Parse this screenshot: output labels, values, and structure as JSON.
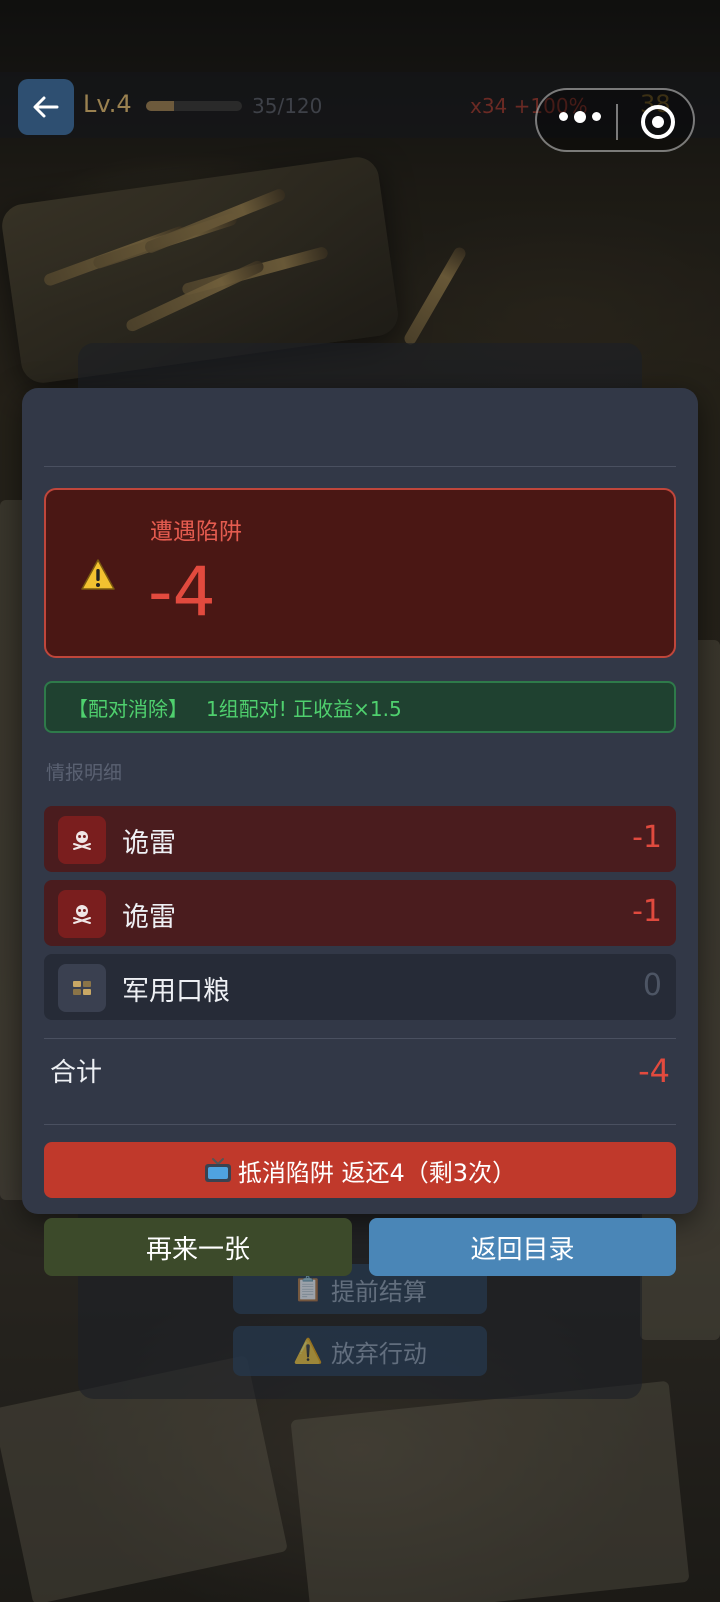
{
  "header": {
    "level": "Lv.4",
    "xp_text": "35/120",
    "xp_fraction": 0.29,
    "multiplier": "x34 +100%",
    "coins": "38"
  },
  "background_menu": {
    "settle_label": "提前结算",
    "abandon_label": "放弃行动"
  },
  "result": {
    "trap_title": "遭遇陷阱",
    "trap_value": "-4",
    "combo_tag": "【配对消除】",
    "combo_text": "1组配对! 正收益×1.5",
    "details_label": "情报明细",
    "items": [
      {
        "name": "诡雷",
        "value": "-1",
        "icon": "skull-icon",
        "type": "bad"
      },
      {
        "name": "诡雷",
        "value": "-1",
        "icon": "skull-icon",
        "type": "bad"
      },
      {
        "name": "军用口粮",
        "value": "0",
        "icon": "ration-icon",
        "type": "neutral"
      }
    ],
    "total_label": "合计",
    "total_value": "-4"
  },
  "actions": {
    "ad_button_label": "抵消陷阱  返还4（剩3次）",
    "again_label": "再来一张",
    "menu_label": "返回目录"
  },
  "colors": {
    "danger": "#e24a3e",
    "success": "#4fd06e",
    "primary": "#4a86b7"
  }
}
